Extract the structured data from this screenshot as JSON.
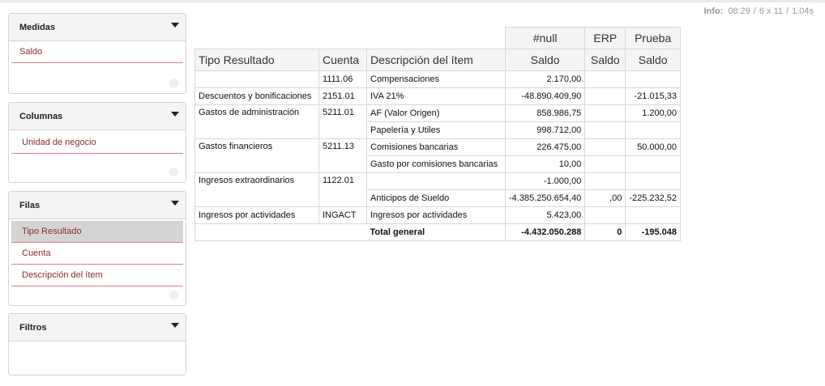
{
  "info": {
    "label": "Info:",
    "time": "08:29",
    "dims": "6 x 11",
    "duration": "1.04s"
  },
  "panels": {
    "medidas": {
      "title": "Medidas",
      "items": [
        "Saldo"
      ]
    },
    "columnas": {
      "title": "Columnas",
      "items": [
        "Unidad de negocio"
      ]
    },
    "filas": {
      "title": "Filas",
      "items": [
        "Tipo Resultado",
        "Cuenta",
        "Descripción del ítem"
      ]
    },
    "filtros": {
      "title": "Filtros"
    }
  },
  "table": {
    "col_groups": [
      "#null",
      "ERP",
      "Prueba"
    ],
    "row_headers": [
      "Tipo Resultado",
      "Cuenta",
      "Descripción del ítem"
    ],
    "measure": "Saldo",
    "rows": [
      {
        "tipo": "",
        "cuenta": "1111.06",
        "desc": "Compensaciones",
        "null": "2.170,00",
        "erp": "",
        "prueba": ""
      },
      {
        "tipo": "Descuentos y bonificaciones",
        "cuenta": "2151.01",
        "desc": "IVA 21%",
        "null": "-48.890.409,90",
        "erp": "",
        "prueba": "-21.015,33"
      },
      {
        "tipo": "Gastos de administración",
        "cuenta": "5211.01",
        "desc": "AF (Valor Origen)",
        "null": "858.986,75",
        "erp": "",
        "prueba": "1.200,00"
      },
      {
        "tipo": "",
        "cuenta": "",
        "desc": "Papelería y Utiles",
        "null": "998.712,00",
        "erp": "",
        "prueba": ""
      },
      {
        "tipo": "Gastos financieros",
        "cuenta": "5211.13",
        "desc": "Comisiones bancarias",
        "null": "226.475,00",
        "erp": "",
        "prueba": "50.000,00"
      },
      {
        "tipo": "",
        "cuenta": "",
        "desc": "Gasto por comisiones bancarias",
        "null": "10,00",
        "erp": "",
        "prueba": ""
      },
      {
        "tipo": "Ingresos extraordinarios",
        "cuenta": "1122.01",
        "desc": "",
        "null": "-1.000,00",
        "erp": "",
        "prueba": ""
      },
      {
        "tipo": "",
        "cuenta": "",
        "desc": "Anticipos de Sueldo",
        "null": "-4.385.250.654,40",
        "erp": ",00",
        "prueba": "-225.232,52"
      },
      {
        "tipo": "Ingresos por actividades",
        "cuenta": "INGACT",
        "desc": "Ingresos por actividades",
        "null": "5.423,00",
        "erp": "",
        "prueba": ""
      }
    ],
    "total": {
      "label": "Total general",
      "null": "-4.432.050.288",
      "erp": "0",
      "prueba": "-195.048"
    }
  }
}
